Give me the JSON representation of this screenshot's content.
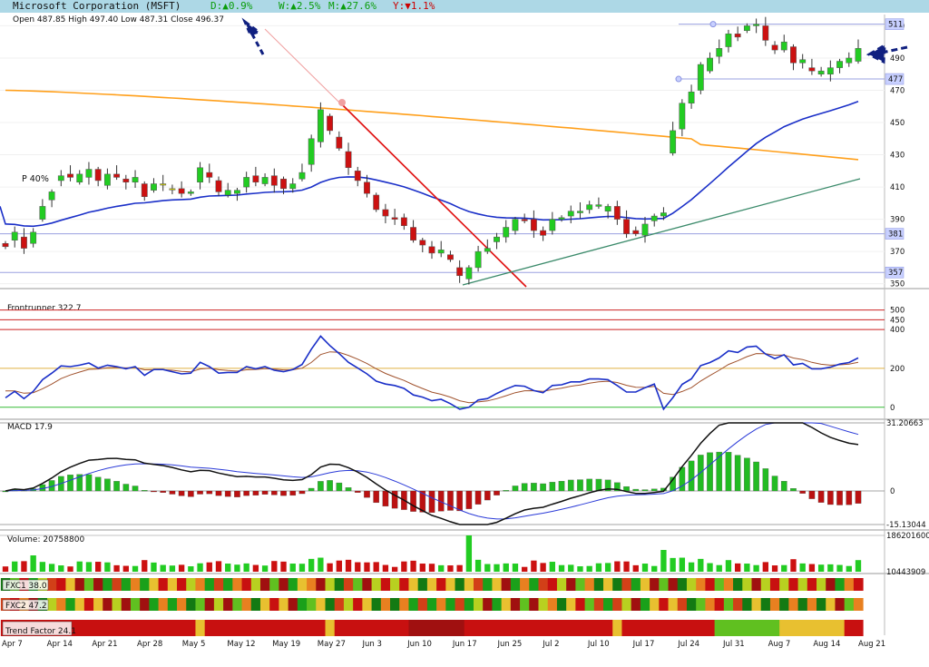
{
  "header": {
    "title": "Microsoft Corporation (MSFT)",
    "day": "D:▲0.9%",
    "week": "W:▲2.5%",
    "month": "M:▲27.6%",
    "year": "Y:▼1.1%"
  },
  "ohlc_text": "Open 487.85  High 497.40  Low 487.31  Close 496.37",
  "chart_data": {
    "type": "candlestick",
    "x_labels": [
      "Apr 7",
      "Apr 14",
      "Apr 21",
      "Apr 28",
      "May 5",
      "May 12",
      "May 19",
      "May 27",
      "Jun 3",
      "Jun 10",
      "Jun 17",
      "Jun 25",
      "Jul 2",
      "Jul 10",
      "Jul 17",
      "Jul 24",
      "Jul 31",
      "Aug 7",
      "Aug 14",
      "Aug 21"
    ],
    "price_axis": {
      "ticks": [
        350,
        370,
        390,
        410,
        430,
        450,
        470,
        490,
        510
      ],
      "range": [
        347,
        517
      ]
    },
    "price_levels": [
      {
        "value": 511,
        "label": "511"
      },
      {
        "value": 477,
        "label": "477"
      },
      {
        "value": 381,
        "label": "381"
      },
      {
        "value": 357,
        "label": "357"
      }
    ],
    "pattern_label": "P 40%",
    "closes": [
      373,
      382,
      372,
      382,
      398,
      407,
      417,
      416,
      418,
      421,
      414,
      418,
      416,
      413,
      416,
      404,
      412,
      412,
      409,
      406,
      407,
      422,
      416,
      407,
      408,
      408,
      416,
      413,
      416,
      411,
      409,
      412,
      419,
      440,
      458,
      445,
      434,
      422,
      414,
      406,
      396,
      392,
      390,
      386,
      377,
      374,
      369,
      371,
      365,
      355,
      360,
      370,
      372,
      379,
      385,
      390,
      389,
      383,
      380,
      390,
      391,
      395,
      395,
      399,
      399,
      398,
      390,
      381,
      381,
      387,
      392,
      394,
      445,
      462,
      469,
      486,
      490,
      496,
      505,
      503,
      510,
      511,
      501,
      495,
      500,
      487,
      489,
      482,
      482,
      484,
      488,
      490,
      496
    ],
    "opens": [
      375,
      377,
      379,
      375,
      390,
      402,
      414,
      418,
      413,
      416,
      421,
      411,
      418,
      415,
      413,
      412,
      408,
      412,
      409,
      409,
      406,
      413,
      419,
      414,
      405,
      406,
      410,
      417,
      412,
      417,
      415,
      409,
      415,
      424,
      438,
      454,
      441,
      432,
      420,
      413,
      405,
      396,
      391,
      391,
      385,
      377,
      373,
      369,
      368,
      360,
      353,
      360,
      370,
      376,
      379,
      383,
      390,
      390,
      383,
      383,
      390,
      392,
      394,
      396,
      398,
      395,
      398,
      390,
      383,
      380,
      389,
      392,
      431,
      446,
      462,
      470,
      482,
      491,
      497,
      505,
      507,
      510,
      510,
      498,
      495,
      497,
      487,
      484,
      480,
      480,
      484,
      487,
      488
    ],
    "ma_orange": {
      "start": 470,
      "end": 430
    },
    "overlays": [
      "downtrend-line",
      "uptrend-line",
      "blue-moving-average",
      "orange-moving-average"
    ],
    "frontrunner": {
      "label": "Frontrunner 322.7",
      "levels": [
        500,
        450,
        400,
        200,
        0
      ]
    },
    "macd": {
      "label": "MACD 17.9",
      "top": "31.20663",
      "zero": "0",
      "bottom": "-15.13044"
    },
    "volume": {
      "label": "Volume: 20758800",
      "top": "186201600",
      "bottom": "10443909"
    },
    "bars": [
      {
        "label": "FXC1 38.0"
      },
      {
        "label": "FXC2 47.2"
      },
      {
        "label": "Trend Factor 24.1"
      }
    ],
    "colors": {
      "up": "#22cc22",
      "down": "#cc1111",
      "neutral": "#cccc00",
      "ma_blue": "#1a2fc8",
      "ma_orange": "#ff9f1a"
    }
  }
}
